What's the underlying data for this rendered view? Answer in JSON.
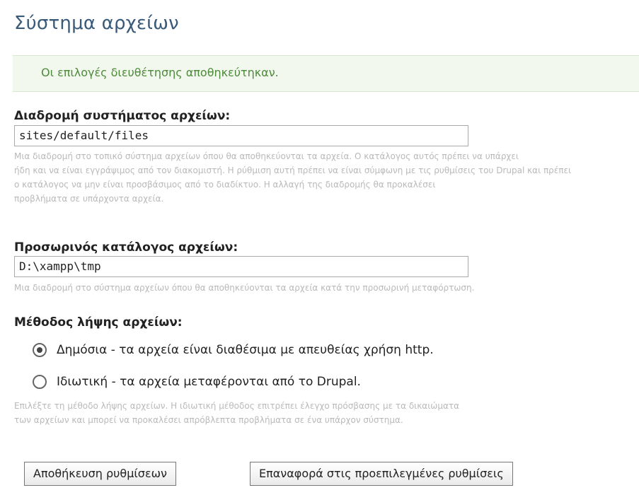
{
  "page": {
    "title": "Σύστημα αρχείων"
  },
  "status": {
    "message": "Οι επιλογές διευθέτησης αποθηκεύτηκαν."
  },
  "fields": {
    "file_system_path": {
      "label": "Διαδρομή συστήματος αρχείων:",
      "value": "sites/default/files",
      "description": [
        "Μια διαδρομή στο τοπικό σύστημα αρχείων όπου θα αποθηκεύονται τα αρχεία. Ο κατάλογος αυτός πρέπει να υπάρχει",
        "ήδη και να είναι εγγράψιμος από τον διακομιστή. Η ρύθμιση αυτή πρέπει να είναι σύμφωνη με τις ρυθμίσεις του Drupal και πρέπει",
        "ο κατάλογος να μην είναι προσβάσιμος από το διαδίκτυο. Η αλλαγή της διαδρομής θα προκαλέσει",
        "προβλήματα σε υπάρχοντα αρχεία."
      ]
    },
    "temp_directory": {
      "label": "Προσωρινός κατάλογος αρχείων:",
      "value": "D:\\xampp\\tmp",
      "description": "Μια διαδρομή στο σύστημα αρχείων όπου θα αποθηκεύονται τα αρχεία κατά την προσωρινή μεταφόρτωση."
    },
    "download_method": {
      "label": "Μέθοδος λήψης αρχείων:",
      "options": [
        {
          "label": "Δημόσια - τα αρχεία είναι διαθέσιμα με απευθείας χρήση http.",
          "checked": true
        },
        {
          "label": "Ιδιωτική - τα αρχεία μεταφέρονται από το Drupal.",
          "checked": false
        }
      ],
      "description": [
        "Επιλέξτε τη μέθοδο λήψης αρχείων. Η ιδιωτική μέθοδος επιτρέπει έλεγχο πρόσβασης με τα δικαιώματα",
        "των αρχείων και μπορεί να προκαλέσει απρόβλεπτα προβλήματα σε ένα υπάρχον σύστημα."
      ]
    }
  },
  "buttons": {
    "save": "Αποθήκευση ρυθμίσεων",
    "reset": "Επαναφορά στις προεπιλεγμένες ρυθμίσεις"
  }
}
